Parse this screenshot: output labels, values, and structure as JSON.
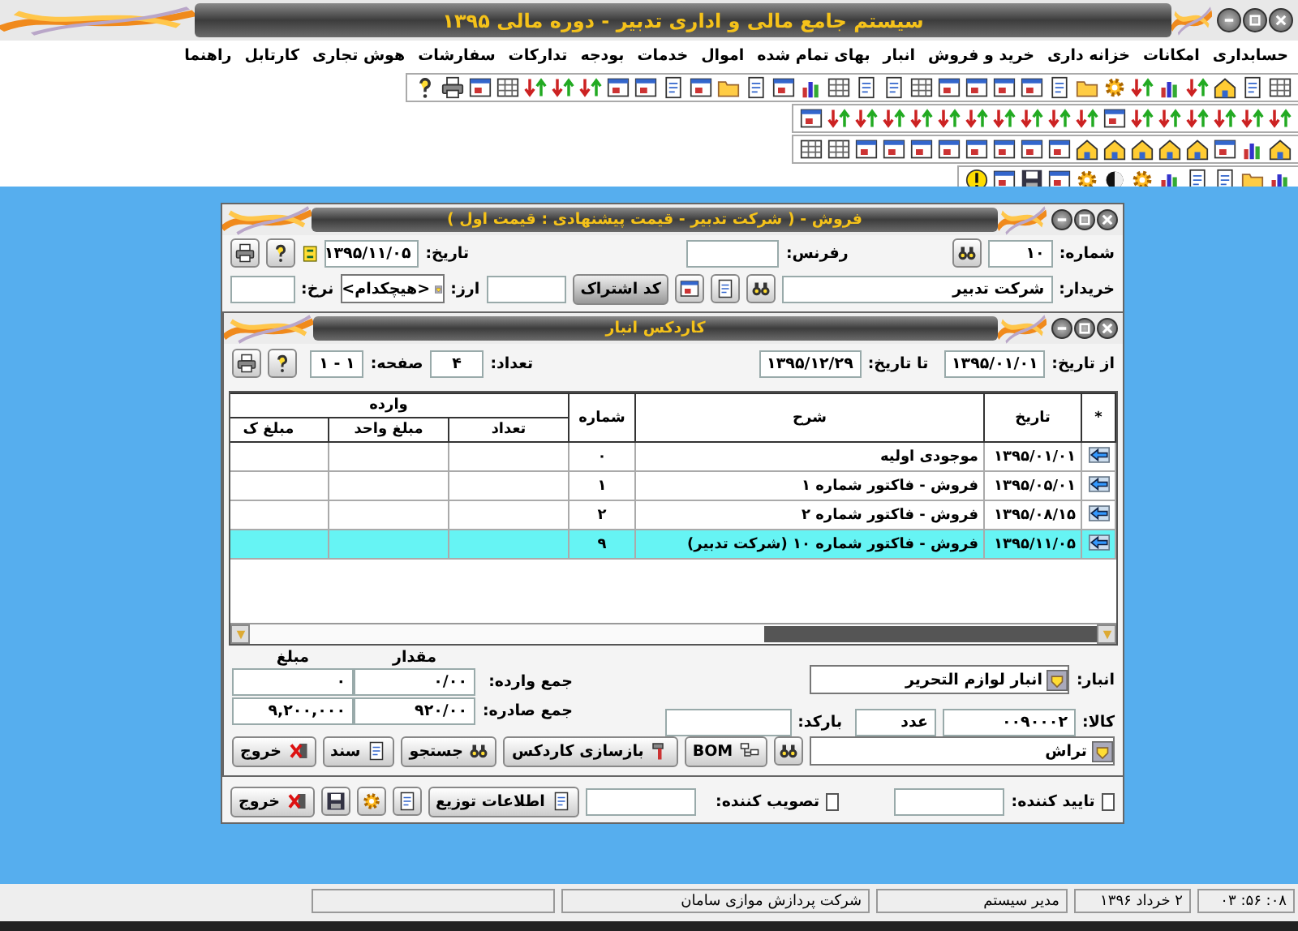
{
  "app": {
    "title": "سیستم جامع مالی و اداری تدبیر - دوره مالی ۱۳۹۵"
  },
  "menu": [
    {
      "label": "حسابداری"
    },
    {
      "label": "امکانات"
    },
    {
      "label": "خزانه داری"
    },
    {
      "label": "خرید و فروش"
    },
    {
      "label": "انبار"
    },
    {
      "label": "بهای تمام شده"
    },
    {
      "label": "اموال"
    },
    {
      "label": "خدمات"
    },
    {
      "label": "بودجه"
    },
    {
      "label": "تدارکات"
    },
    {
      "label": "سفارشات"
    },
    {
      "label": "هوش تجاری"
    },
    {
      "label": "کارتابل"
    },
    {
      "label": "راهنما"
    }
  ],
  "sales_window": {
    "title": "فروش - ( شرکت تدبیر - قیمت پیشنهادی : قیمت اول )",
    "number_label": "شماره:",
    "number": "۱۰",
    "reference_label": "رفرنس:",
    "date_label": "تاریخ:",
    "date": "۱۳۹۵/۱۱/۰۵",
    "buyer_label": "خریدار:",
    "buyer": "شرکت تدبیر",
    "subscription_button": "کد اشتراک",
    "currency_label": "ارز:",
    "currency": "<هیچکدام>",
    "rate_label": "نرخ:",
    "approver": {
      "label": "تایید کننده:",
      "checked": false
    },
    "ratifier": {
      "label": "تصویب کننده:",
      "checked": false
    },
    "distribution_button": "اطلاعات توزیع",
    "exit_button": "خروج"
  },
  "kardex_window": {
    "title": "کاردکس انبار",
    "from_label": "از تاریخ:",
    "from": "۱۳۹۵/۰۱/۰۱",
    "to_label": "تا تاریخ:",
    "to": "۱۳۹۵/۱۲/۲۹",
    "count_label": "تعداد:",
    "count": "۴",
    "page_label": "صفحه:",
    "page": "۱ - ۱",
    "table": {
      "columns": [
        "*",
        "تاریخ",
        "شرح",
        "شماره"
      ],
      "group": "وارده",
      "group_columns": [
        "تعداد",
        "مبلغ واحد",
        "مبلغ ک"
      ],
      "rows": [
        {
          "date": "۱۳۹۵/۰۱/۰۱",
          "description": "موجودی اولیه",
          "number": "۰",
          "selected": false
        },
        {
          "date": "۱۳۹۵/۰۵/۰۱",
          "description": "فروش - فاکتور شماره ۱",
          "number": "۱",
          "selected": false
        },
        {
          "date": "۱۳۹۵/۰۸/۱۵",
          "description": "فروش - فاکتور شماره ۲",
          "number": "۲",
          "selected": false
        },
        {
          "date": "۱۳۹۵/۱۱/۰۵",
          "description": "فروش - فاکتور شماره ۱۰ (شرکت تدبیر)",
          "number": "۹",
          "selected": true
        }
      ]
    },
    "warehouse_label": "انبار:",
    "warehouse": "انبار لوازم التحریر",
    "quantity_label": "مقدار",
    "amount_label": "مبلغ",
    "in_total_label": "جمع وارده:",
    "in_quantity": "۰/۰۰",
    "in_amount": "۰",
    "out_total_label": "جمع صادره:",
    "out_quantity": "۹۲۰/۰۰",
    "out_amount": "۹,۲۰۰,۰۰۰",
    "item_label": "کالا:",
    "item_code": "۰۰۹۰۰۰۲",
    "unit": "عدد",
    "barcode_label": "بارکد:",
    "item_name": "تراش",
    "buttons": [
      {
        "kind": "bom",
        "label": "BOM"
      },
      {
        "kind": "rebuild",
        "label": "بازسازی کاردکس"
      },
      {
        "kind": "search",
        "label": "جستجو"
      },
      {
        "kind": "document",
        "label": "سند"
      },
      {
        "kind": "exit",
        "label": "خروج"
      }
    ]
  },
  "status_bar": {
    "time": "۰۸: ۵۶: ۰۳",
    "date": "۲ خرداد ۱۳۹۶",
    "user": "مدیر سیستم",
    "company": "شرکت پردازش موازی سامان"
  }
}
